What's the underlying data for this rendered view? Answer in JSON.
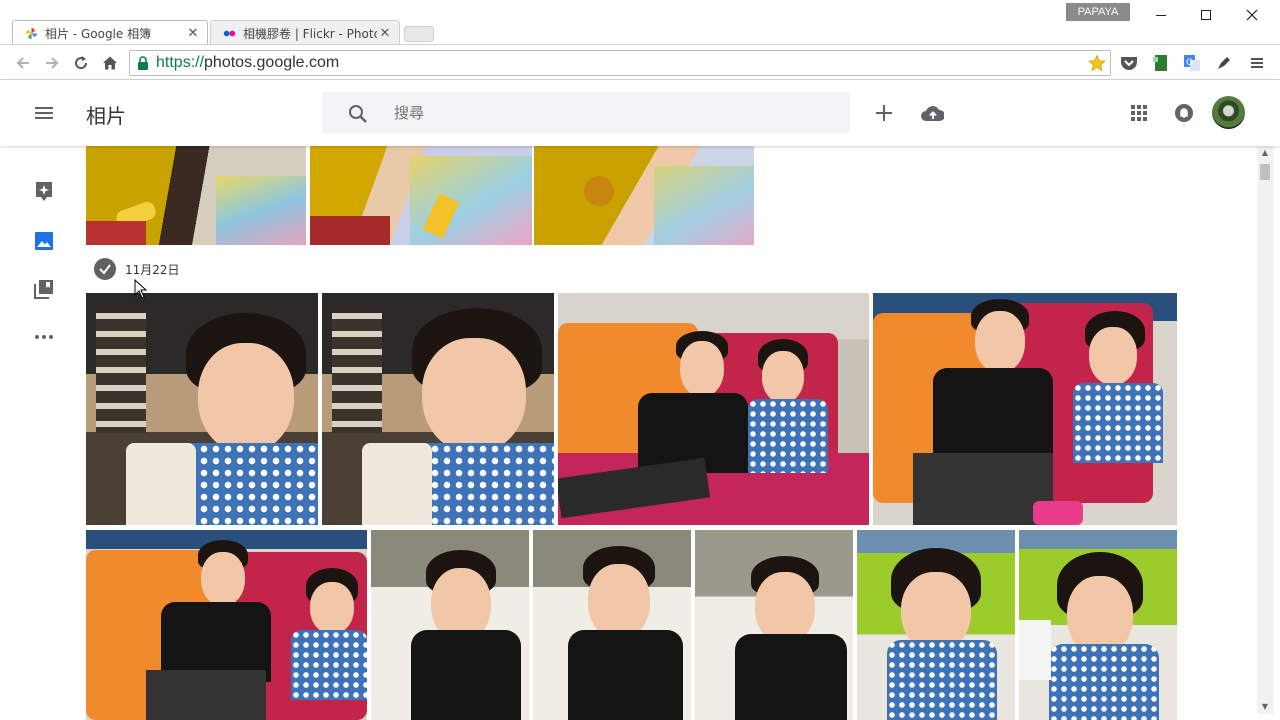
{
  "browser": {
    "tabs": [
      {
        "label": "相片 - Google 相簿",
        "active": true,
        "icon": "google-photos-pinwheel-icon"
      },
      {
        "label": "相機膠卷 | Flickr - Photo",
        "active": false,
        "icon": "flickr-dots-icon"
      }
    ],
    "profile_badge": "PAPAYA",
    "url_scheme": "https://",
    "url_host": "photos.google.com"
  },
  "app": {
    "title": "相片",
    "search_placeholder": "搜尋",
    "accent": "#1a73e8"
  },
  "sections": [
    {
      "date": "11月22日"
    }
  ],
  "nav": [
    "assistant-icon",
    "photos-icon",
    "albums-icon",
    "more-icon"
  ]
}
